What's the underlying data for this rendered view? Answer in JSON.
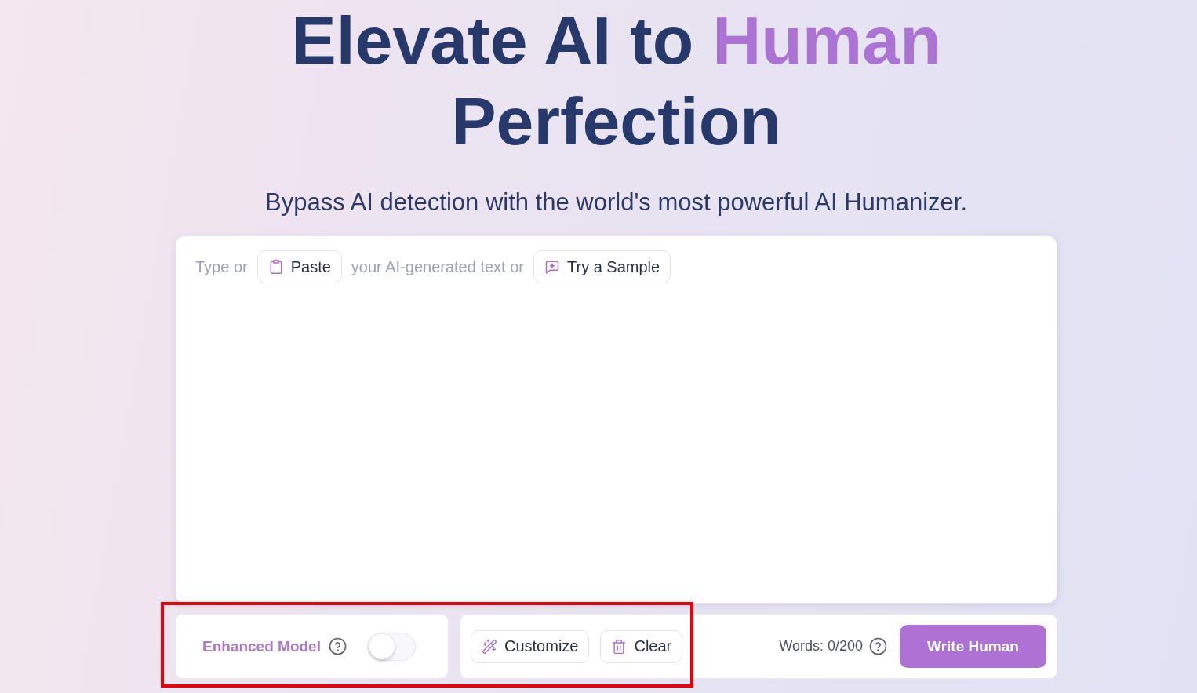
{
  "hero": {
    "title_lines": [
      {
        "parts": [
          {
            "text": "Elevate AI to",
            "accent": false
          },
          {
            "text": "Human",
            "accent": true
          }
        ]
      },
      {
        "parts": [
          {
            "text": "Perfection",
            "accent": false
          }
        ]
      }
    ],
    "subtitle": "Bypass AI detection with the world's most powerful AI Humanizer."
  },
  "editor": {
    "prompt": {
      "lead": "Type or",
      "paste_button": "Paste",
      "middle": "your AI-generated text or",
      "sample_button": "Try a Sample"
    }
  },
  "model_panel": {
    "label": "Enhanced Model",
    "on": false
  },
  "actions": {
    "customize_button": "Customize",
    "clear_button": "Clear",
    "word_count": "Words: 0/200",
    "submit_button": "Write Human"
  }
}
